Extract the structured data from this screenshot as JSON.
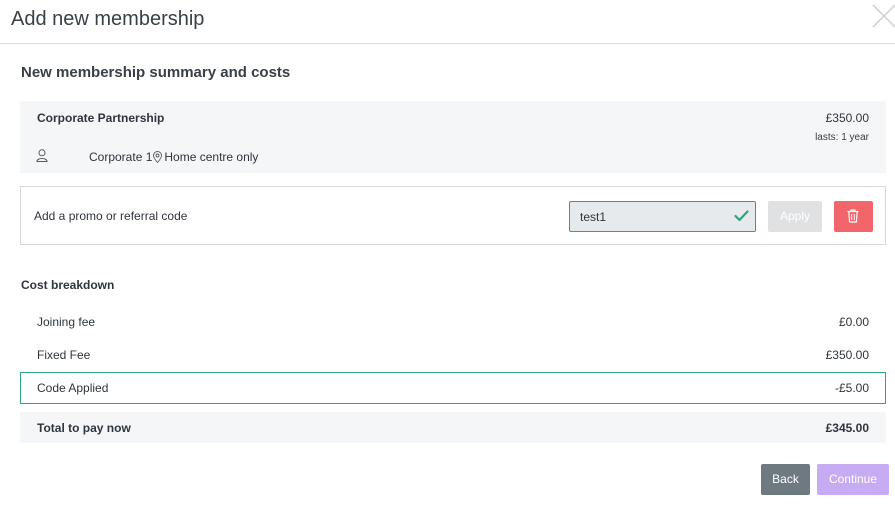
{
  "modal": {
    "title": "Add new membership",
    "close_icon": "close-icon"
  },
  "summary": {
    "section_title": "New membership summary and costs",
    "plan_name": "Corporate Partnership",
    "price": "£350.00",
    "duration": "lasts: 1 year",
    "member": "Corporate 1",
    "location": "Home centre only",
    "user_icon": "user-icon",
    "location_icon": "map-pin-icon"
  },
  "promo": {
    "label": "Add a promo or referral code",
    "code_value": "test1",
    "apply_label": "Apply",
    "valid_icon": "check-icon",
    "delete_icon": "trash-icon",
    "valid_color": "#2aa584",
    "delete_color": "#f2656a"
  },
  "breakdown": {
    "title": "Cost breakdown",
    "rows": [
      {
        "label": "Joining fee",
        "amount": "£0.00"
      },
      {
        "label": "Fixed Fee",
        "amount": "£350.00"
      },
      {
        "label": "Code Applied",
        "amount": "-£5.00"
      }
    ],
    "total_label": "Total to pay now",
    "total_amount": "£345.00"
  },
  "footer": {
    "back_label": "Back",
    "continue_label": "Continue",
    "back_color": "#6e7a80",
    "continue_color": "#c8acf3"
  }
}
